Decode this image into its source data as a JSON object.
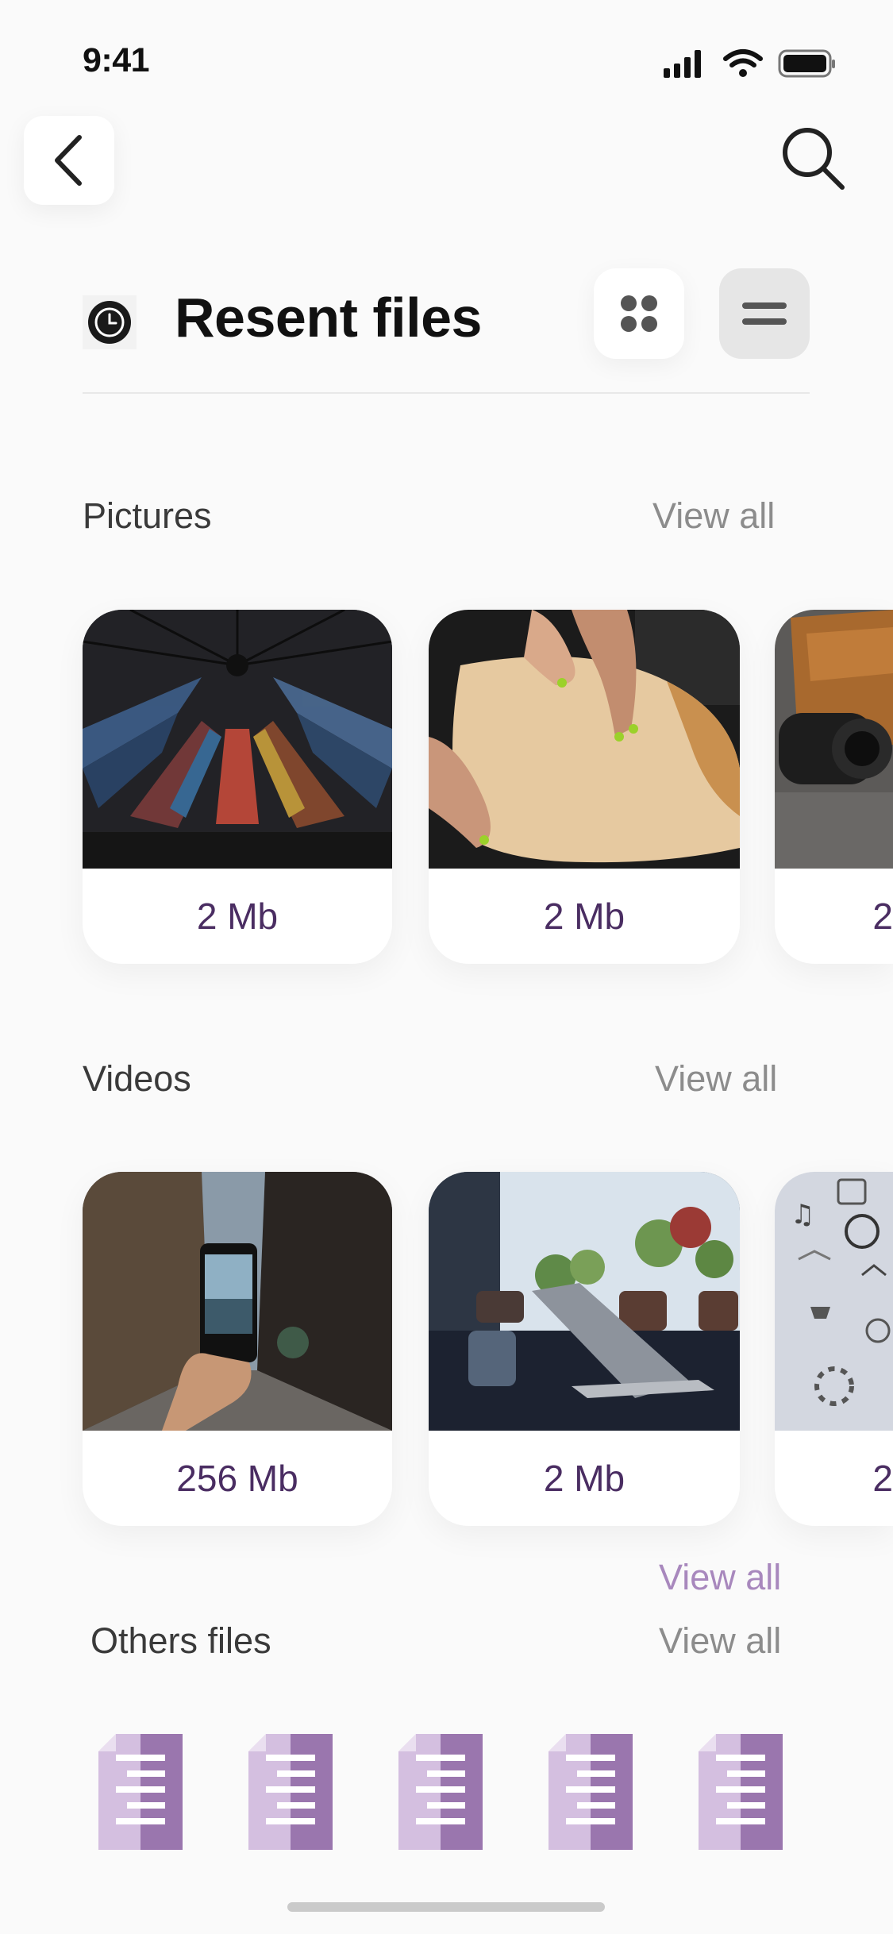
{
  "status_bar": {
    "time": "9:41"
  },
  "nav": {
    "back_icon": "chevron-left-icon",
    "search_icon": "search-icon"
  },
  "header": {
    "icon": "clock-icon",
    "title": "Resent files",
    "grid_view_icon": "grid-icon",
    "list_view_icon": "list-icon"
  },
  "pictures": {
    "title": "Pictures",
    "view_all": "View all",
    "items": [
      {
        "size": "2 Mb",
        "image": "cathedral-stained-glass"
      },
      {
        "size": "2 Mb",
        "image": "hands-pastry-dough"
      },
      {
        "size": "2",
        "image": "camera-leather-bag"
      }
    ]
  },
  "videos": {
    "title": "Videos",
    "view_all": "View all",
    "items": [
      {
        "size": "256 Mb",
        "image": "phone-photo-street"
      },
      {
        "size": "2 Mb",
        "image": "laptop-plants"
      },
      {
        "size": "2",
        "image": "icons-wall"
      }
    ]
  },
  "others": {
    "title": "Others files",
    "view_all": "View all",
    "view_all_accent": "View all",
    "file_icon": "document-icon",
    "file_count": 5
  },
  "colors": {
    "accent": "#4a2d62",
    "file_light": "#d4bfe0",
    "file_dark": "#9a76ae",
    "background": "#fafafa"
  }
}
